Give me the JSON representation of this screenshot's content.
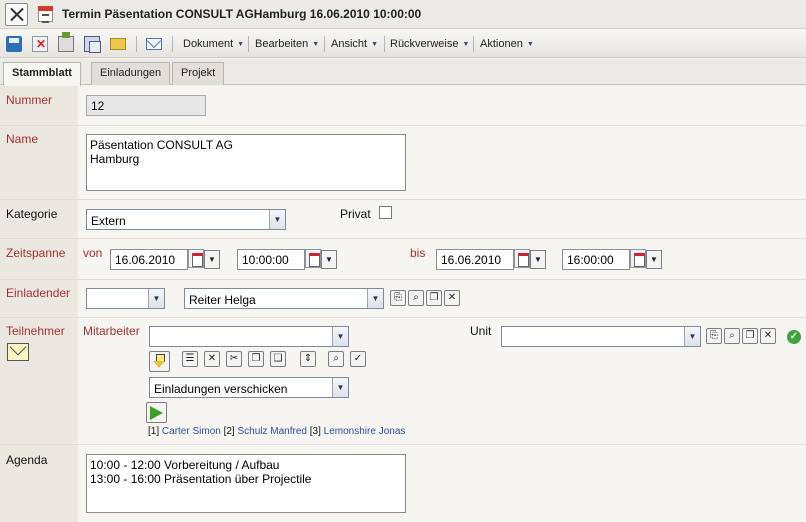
{
  "window": {
    "title": "Termin Päsentation CONSULT AGHamburg 16.06.2010 10:00:00"
  },
  "toolbar": {
    "menus": [
      "Dokument",
      "Bearbeiten",
      "Ansicht",
      "Rückverweise",
      "Aktionen"
    ]
  },
  "tabs": [
    "Stammblatt",
    "Einladungen",
    "Projekt"
  ],
  "form": {
    "nummer": {
      "label": "Nummer",
      "value": "12"
    },
    "name": {
      "label": "Name",
      "value": "Päsentation CONSULT AG\nHamburg"
    },
    "kategorie": {
      "label": "Kategorie",
      "value": "Extern"
    },
    "privat": {
      "label": "Privat",
      "checked": false
    },
    "zeitspanne": {
      "label": "Zeitspanne",
      "von_label": "von",
      "bis_label": "bis",
      "von_date": "16.06.2010",
      "von_time": "10:00:00",
      "bis_date": "16.06.2010",
      "bis_time": "16:00:00"
    },
    "einladender": {
      "label": "Einladender",
      "first": "",
      "value": "Reiter Helga"
    },
    "teilnehmer": {
      "label": "Teilnehmer",
      "mitarbeiter_label": "Mitarbeiter",
      "mitarbeiter_value": "",
      "unit_label": "Unit",
      "unit_value": "",
      "action_select": "Einladungen verschicken",
      "participants": [
        {
          "index": "[1]",
          "name": "Carter Simon"
        },
        {
          "index": "[2]",
          "name": "Schulz Manfred"
        },
        {
          "index": "[3]",
          "name": "Lemonshire Jonas"
        }
      ]
    },
    "agenda": {
      "label": "Agenda",
      "value": "10:00 - 12:00 Vorbereitung / Aufbau\n13:00 - 16:00 Präsentation über Projectile"
    }
  },
  "colors": {
    "required_label": "#a33030",
    "link": "#2a4f9e"
  },
  "icons": [
    "close-icon",
    "calendar-icon",
    "save-icon",
    "delete-icon",
    "print-icon",
    "copy-icon",
    "folder-icon",
    "mail-icon"
  ]
}
